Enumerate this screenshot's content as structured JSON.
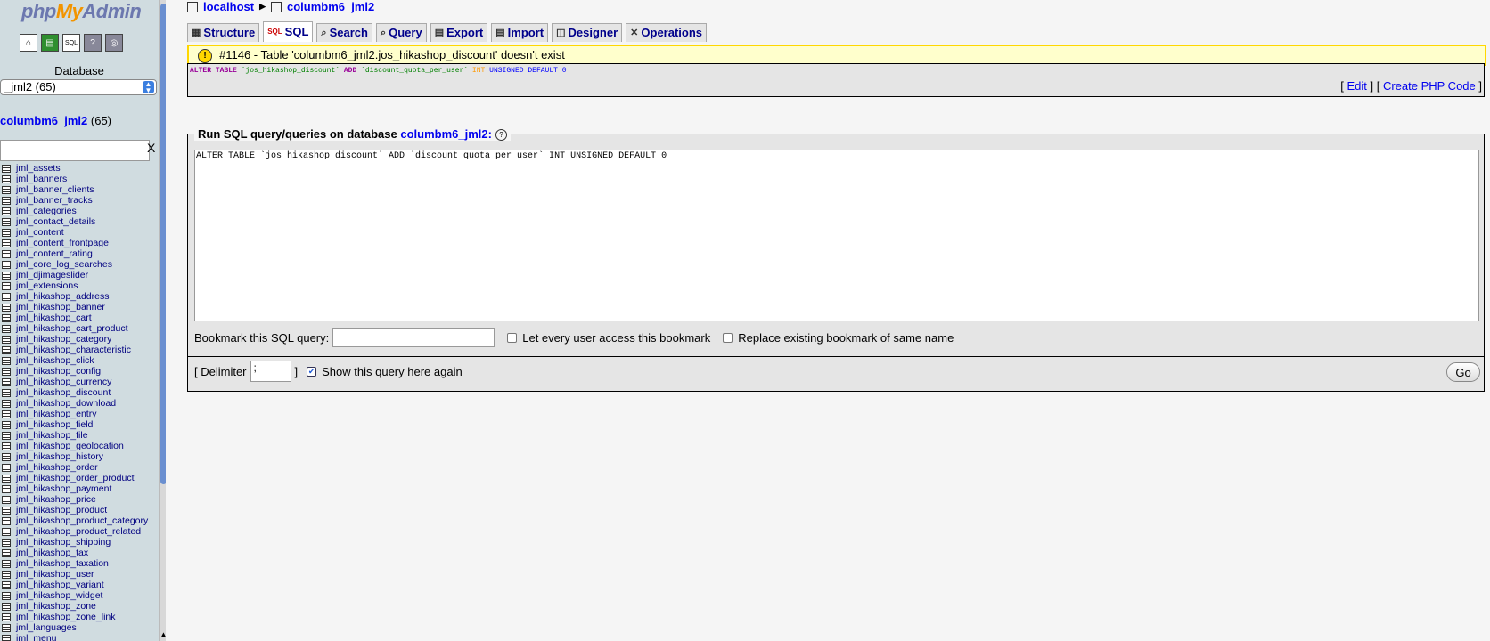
{
  "nav": {
    "logo": {
      "php": "php",
      "my": "My",
      "admin": "Admin"
    },
    "database_label": "Database",
    "db_select": "_jml2 (65)",
    "db_name": "columbm6_jml2",
    "db_count": "(65)",
    "filter_clear": "X",
    "tables": [
      "jml_assets",
      "jml_banners",
      "jml_banner_clients",
      "jml_banner_tracks",
      "jml_categories",
      "jml_contact_details",
      "jml_content",
      "jml_content_frontpage",
      "jml_content_rating",
      "jml_core_log_searches",
      "jml_djimageslider",
      "jml_extensions",
      "jml_hikashop_address",
      "jml_hikashop_banner",
      "jml_hikashop_cart",
      "jml_hikashop_cart_product",
      "jml_hikashop_category",
      "jml_hikashop_characteristic",
      "jml_hikashop_click",
      "jml_hikashop_config",
      "jml_hikashop_currency",
      "jml_hikashop_discount",
      "jml_hikashop_download",
      "jml_hikashop_entry",
      "jml_hikashop_field",
      "jml_hikashop_file",
      "jml_hikashop_geolocation",
      "jml_hikashop_history",
      "jml_hikashop_order",
      "jml_hikashop_order_product",
      "jml_hikashop_payment",
      "jml_hikashop_price",
      "jml_hikashop_product",
      "jml_hikashop_product_category",
      "jml_hikashop_product_related",
      "jml_hikashop_shipping",
      "jml_hikashop_tax",
      "jml_hikashop_taxation",
      "jml_hikashop_user",
      "jml_hikashop_variant",
      "jml_hikashop_widget",
      "jml_hikashop_zone",
      "jml_hikashop_zone_link",
      "jml_languages",
      "jml_menu"
    ]
  },
  "breadcrumb": {
    "server": "localhost",
    "database": "columbm6_jml2"
  },
  "tabs": [
    "Structure",
    "SQL",
    "Search",
    "Query",
    "Export",
    "Import",
    "Designer",
    "Operations"
  ],
  "error": {
    "message": "#1146 - Table 'columbm6_jml2.jos_hikashop_discount' doesn't exist"
  },
  "query_display": {
    "kw_alter": "ALTER TABLE",
    "tbl": "`jos_hikashop_discount`",
    "kw_add": "ADD",
    "col": "`discount_quota_per_user`",
    "kw_int": "INT",
    "rest": "UNSIGNED DEFAULT 0",
    "edit_link": "Edit",
    "php_link": "Create PHP Code"
  },
  "sql_form": {
    "legend_prefix": "Run SQL query/queries on database",
    "legend_db": "columbm6_jml2:",
    "help": "?",
    "query_text": "ALTER TABLE `jos_hikashop_discount` ADD `discount_quota_per_user` INT UNSIGNED DEFAULT 0",
    "bookmark_label": "Bookmark this SQL query:",
    "share_label": "Let every user access this bookmark",
    "replace_label": "Replace existing bookmark of same name",
    "delimiter_open": "[ Delimiter",
    "delimiter_value": ";",
    "delimiter_close": "]",
    "show_again_label": "Show this query here again",
    "go_label": "Go"
  }
}
